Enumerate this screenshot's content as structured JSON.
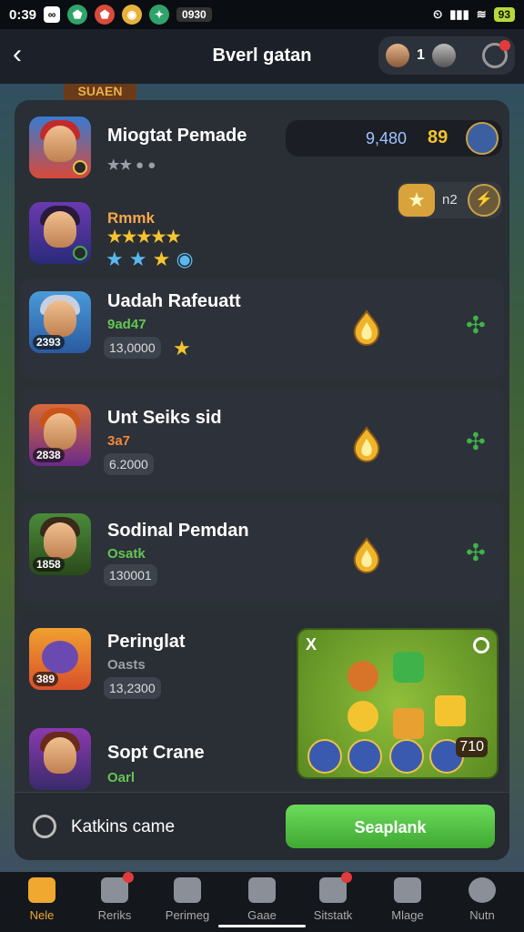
{
  "status": {
    "time": "0:39",
    "center": "0930",
    "battery": "93"
  },
  "header": {
    "title": "Bverl gatan",
    "badge_num": "1"
  },
  "scene_sign": "SUAEN",
  "panel": {
    "search_value": "9,480",
    "search_count": "89",
    "pill_text": "n2",
    "rows": [
      {
        "name": "Miogtat Pemade",
        "sub": "★★ ● ●",
        "sub_color": "#9aa0a8",
        "tag": ""
      },
      {
        "name": "Rmmk",
        "sub": "★★★★★",
        "sub_color": "#f4c430",
        "tag": ""
      },
      {
        "name": "Uadah Rafeuatt",
        "sub": "9ad47",
        "sub_color": "#63c653",
        "tag": "2393",
        "chip": "13,0000"
      },
      {
        "name": "Unt Seiks sid",
        "sub": "3a7",
        "sub_color": "#f08a3a",
        "tag": "2838",
        "chip": "6.2000"
      },
      {
        "name": "Sodinal Pemdan",
        "sub": "Osatk",
        "sub_color": "#63c653",
        "tag": "1858",
        "chip": "130001"
      },
      {
        "name": "Peringlat",
        "sub": "Oasts",
        "sub_color": "#9aa0a8",
        "tag": "389",
        "chip": "13,2300"
      },
      {
        "name": "Sopt Crane",
        "sub": "Oarl",
        "sub_color": "#63c653",
        "tag": ""
      }
    ],
    "game": {
      "x": "X",
      "num": "710"
    }
  },
  "bottom": {
    "label": "Katkins came",
    "cta": "Seaplank"
  },
  "nav": [
    {
      "label": "Nele",
      "active": true
    },
    {
      "label": "Reriks"
    },
    {
      "label": "Perimeg"
    },
    {
      "label": "Gaae"
    },
    {
      "label": "Sitstatk"
    },
    {
      "label": "Mlage"
    },
    {
      "label": "Nutn"
    }
  ]
}
